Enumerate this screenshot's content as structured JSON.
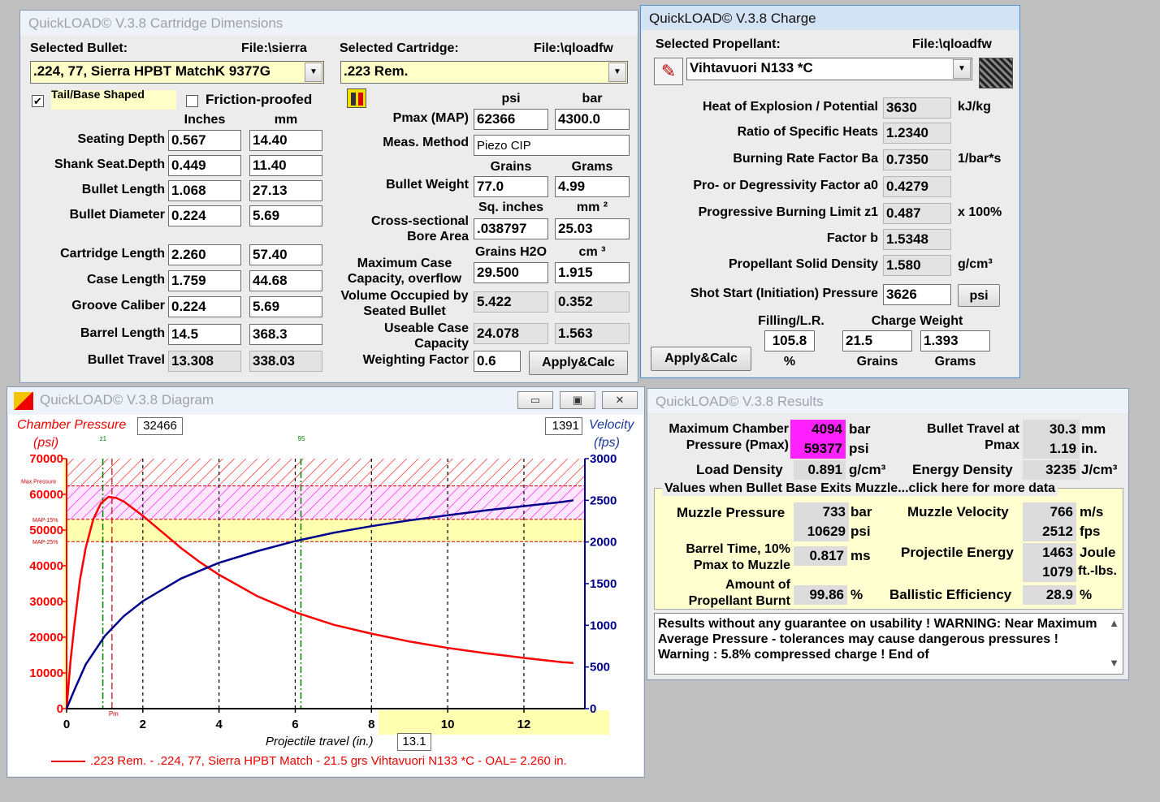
{
  "dims": {
    "title": "QuickLOAD© V.3.8 Cartridge Dimensions",
    "sel_bullet_label": "Selected Bullet:",
    "bullet_file": "File:\\sierra",
    "bullet_value": ".224, 77, Sierra HPBT MatchK 9377G",
    "tail_base_label": "Tail/Base Shaped",
    "friction_label": "Friction-proofed",
    "sel_cart_label": "Selected Cartridge:",
    "cart_file": "File:\\qloadfw",
    "cart_value": ".223 Rem.",
    "col_inches": "Inches",
    "col_mm": "mm",
    "rows": [
      {
        "label": "Seating Depth",
        "inch": "0.567",
        "mm": "14.40"
      },
      {
        "label": "Shank Seat.Depth",
        "inch": "0.449",
        "mm": "11.40"
      },
      {
        "label": "Bullet Length",
        "inch": "1.068",
        "mm": "27.13"
      },
      {
        "label": "Bullet Diameter",
        "inch": "0.224",
        "mm": "5.69"
      },
      {
        "label": "Cartridge Length",
        "inch": "2.260",
        "mm": "57.40"
      },
      {
        "label": "Case Length",
        "inch": "1.759",
        "mm": "44.68"
      },
      {
        "label": "Groove Caliber",
        "inch": "0.224",
        "mm": "5.69"
      },
      {
        "label": "Barrel Length",
        "inch": "14.5",
        "mm": "368.3"
      },
      {
        "label": "Bullet Travel",
        "inch": "13.308",
        "mm": "338.03"
      }
    ],
    "col_psi": "psi",
    "col_bar": "bar",
    "pmax_label": "Pmax (MAP)",
    "pmax_psi": "62366",
    "pmax_bar": "4300.0",
    "meas_label": "Meas. Method",
    "meas_value": "Piezo CIP",
    "col_grains": "Grains",
    "col_grams": "Grams",
    "bw_label": "Bullet Weight",
    "bw_grains": "77.0",
    "bw_grams": "4.99",
    "col_sqin": "Sq. inches",
    "col_mm2": "mm ²",
    "csa_label": "Cross-sectional Bore Area",
    "csa_sqin": ".038797",
    "csa_mm2": "25.03",
    "col_h2o": "Grains H2O",
    "col_cm3": "cm ³",
    "mcc_label": "Maximum Case Capacity, overflow",
    "mcc_gr": "29.500",
    "mcc_cm3": "1.915",
    "vol_label": "Volume Occupied by Seated Bullet",
    "vol_gr": "5.422",
    "vol_cm3": "0.352",
    "ucc_label": "Useable Case Capacity",
    "ucc_gr": "24.078",
    "ucc_cm3": "1.563",
    "wf_label": "Weighting Factor",
    "wf_value": "0.6",
    "apply": "Apply&Calc"
  },
  "charge": {
    "title": "QuickLOAD© V.3.8 Charge",
    "sel_prop_label": "Selected Propellant:",
    "prop_file": "File:\\qloadfw",
    "prop_value": "Vihtavuori N133 *C",
    "rows": [
      {
        "label": "Heat of Explosion / Potential",
        "value": "3630",
        "unit": "kJ/kg"
      },
      {
        "label": "Ratio of Specific Heats",
        "value": "1.2340",
        "unit": ""
      },
      {
        "label": "Burning Rate Factor  Ba",
        "value": "0.7350",
        "unit": "1/bar*s"
      },
      {
        "label": "Pro- or Degressivity Factor  a0",
        "value": "0.4279",
        "unit": ""
      },
      {
        "label": "Progressive Burning Limit z1",
        "value": "0.487",
        "unit": "x 100%"
      },
      {
        "label": "Factor  b",
        "value": "1.5348",
        "unit": ""
      },
      {
        "label": "Propellant Solid Density",
        "value": "1.580",
        "unit": "g/cm³"
      },
      {
        "label": "Shot Start (Initiation) Pressure",
        "value": "3626",
        "unit": "psi"
      }
    ],
    "fill_label": "Filling/L.R.",
    "fill_value": "105.8",
    "fill_unit": "%",
    "cw_label": "Charge Weight",
    "cw_grains": "21.5",
    "cw_grams": "1.393",
    "grains": "Grains",
    "grams": "Grams",
    "apply": "Apply&Calc"
  },
  "diagram": {
    "title": "QuickLOAD© V.3.8 Diagram",
    "cp_label": "Chamber Pressure",
    "cp_unit": "(psi)",
    "cp_value": "32466",
    "vel_value": "1391",
    "vel_label": "Velocity",
    "vel_unit": "(fps)",
    "z1": "z1",
    "zb": "95",
    "pm": "Pm",
    "max_pressure": "Max.Pressure",
    "map15": "MAP-15%",
    "map25": "MAP-25%",
    "xlabel": "Projectile travel (in.)",
    "x_value": "13.1",
    "legend": ".223 Rem. - .224, 77, Sierra HPBT Match - 21.5 grs Vihtavuori N133 *C - OAL= 2.260 in."
  },
  "chart_data": {
    "type": "line",
    "xlabel": "Projectile travel (in.)",
    "ylabel": "Chamber Pressure (psi)",
    "y2label": "Velocity (fps)",
    "xlim": [
      0,
      13.6
    ],
    "ylim": [
      0,
      70000
    ],
    "y2lim": [
      0,
      3000
    ],
    "x_ticks": [
      "0",
      "2",
      "4",
      "6",
      "8",
      "10",
      "12"
    ],
    "y_ticks": [
      "0",
      "10000",
      "20000",
      "30000",
      "40000",
      "50000",
      "60000",
      "70000"
    ],
    "y2_ticks": [
      "0",
      "500",
      "1000",
      "1500",
      "2000",
      "2500",
      "3000"
    ],
    "series": [
      {
        "axis": "left",
        "x": [
          0,
          0.1,
          0.2,
          0.35,
          0.5,
          0.7,
          0.9,
          1.1,
          1.3,
          1.5,
          2,
          2.5,
          3,
          3.5,
          4,
          5,
          6,
          7,
          8,
          9,
          10,
          11,
          12,
          13,
          13.3
        ],
        "values": [
          0,
          13000,
          23000,
          36000,
          45000,
          53000,
          57500,
          59300,
          59000,
          58000,
          54000,
          49500,
          45000,
          41000,
          37500,
          31500,
          27000,
          23500,
          21000,
          18800,
          17000,
          15500,
          14200,
          13000,
          12800
        ]
      },
      {
        "axis": "right",
        "x": [
          0,
          0.2,
          0.5,
          1,
          1.5,
          2,
          3,
          4,
          5,
          6,
          7,
          8,
          9,
          10,
          11,
          12,
          13,
          13.3
        ],
        "values": [
          0,
          220,
          530,
          870,
          1110,
          1290,
          1560,
          1750,
          1890,
          2010,
          2110,
          2190,
          2260,
          2320,
          2380,
          2430,
          2480,
          2500
        ]
      }
    ],
    "grid": true
  },
  "results": {
    "title": "QuickLOAD© V.3.8 Results",
    "mcp_label": "Maximum Chamber Pressure (Pmax)",
    "mcp_bar": "4094",
    "mcp_bar_unit": "bar",
    "mcp_psi": "59377",
    "mcp_psi_unit": "psi",
    "bt_label": "Bullet Travel at Pmax",
    "bt_mm": "30.3",
    "bt_mm_unit": "mm",
    "bt_in": "1.19",
    "bt_in_unit": "in.",
    "ld_label": "Load Density",
    "ld_value": "0.891",
    "ld_unit": "g/cm³",
    "ed_label": "Energy Density",
    "ed_value": "3235",
    "ed_unit": "J/cm³",
    "group_label": "Values when Bullet Base Exits Muzzle...click here for more data",
    "mp_label": "Muzzle Pressure",
    "mp_bar": "733",
    "mp_bar_unit": "bar",
    "mp_psi": "10629",
    "mp_psi_unit": "psi",
    "mv_label": "Muzzle Velocity",
    "mv_ms": "766",
    "mv_ms_unit": "m/s",
    "mv_fps": "2512",
    "mv_fps_unit": "fps",
    "bt10_label": "Barrel Time, 10% Pmax to Muzzle",
    "bt10_value": "0.817",
    "bt10_unit": "ms",
    "pe_label": "Projectile Energy",
    "pe_joule": "1463",
    "pe_joule_unit": "Joule",
    "pe_ftlbs": "1079",
    "pe_ftlbs_unit": "ft.-lbs.",
    "apb_label": "Amount of Propellant Burnt",
    "apb_value": "99.86",
    "apb_unit": "%",
    "be_label": "Ballistic Efficiency",
    "be_value": "28.9",
    "be_unit": "%",
    "warning": "Results without any guarantee on usability !  WARNING: Near Maximum Average Pressure - tolerances may cause dangerous pressures !  Warning : 5.8% compressed charge !  End of"
  },
  "colors": {
    "pressure": "#ff0000",
    "velocity": "#00008b",
    "highlight": "#ff22ff",
    "hatch_red": "#ff0000",
    "hatch_magenta": "#ff00ff",
    "yellow_band": "#ffffb0"
  }
}
